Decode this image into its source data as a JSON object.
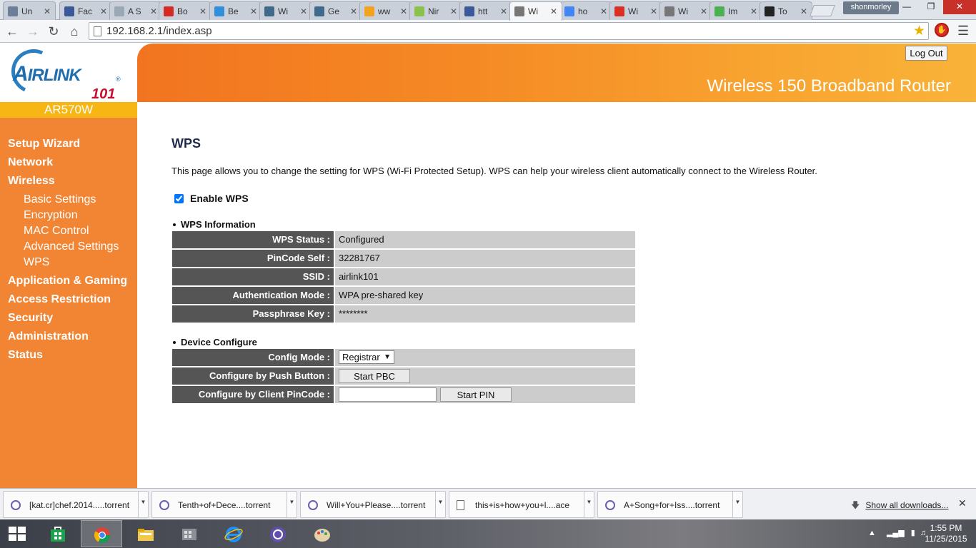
{
  "browser": {
    "tabs": [
      {
        "label": "Un",
        "color": "#6b7f99"
      },
      {
        "label": "Fac",
        "color": "#3b5998"
      },
      {
        "label": "A S",
        "color": "#9aa7b5"
      },
      {
        "label": "Bo",
        "color": "#d62b24"
      },
      {
        "label": "Be",
        "color": "#2f8fd8"
      },
      {
        "label": "Wi",
        "color": "#3f6a8a"
      },
      {
        "label": "Ge",
        "color": "#3f6a8a"
      },
      {
        "label": "ww",
        "color": "#f2a21d"
      },
      {
        "label": "Nir",
        "color": "#8bc34a"
      },
      {
        "label": "htt",
        "color": "#3b5998"
      },
      {
        "label": "Wi",
        "color": "#777777"
      },
      {
        "label": "ho",
        "color": "#4285f4"
      },
      {
        "label": "Wi",
        "color": "#d93025"
      },
      {
        "label": "Wi",
        "color": "#777777"
      },
      {
        "label": "Im",
        "color": "#4caf50"
      },
      {
        "label": "To",
        "color": "#222222"
      }
    ],
    "active_tab_index": 10,
    "profile_name": "shonmorley",
    "url": "192.168.2.1/index.asp"
  },
  "router": {
    "brand_logo": "AIRLINK",
    "brand_logo_small": "101",
    "model": "AR570W",
    "product_title": "Wireless 150 Broadband Router",
    "logout_label": "Log Out",
    "nav": [
      {
        "label": "Setup Wizard",
        "level": "main"
      },
      {
        "label": "Network",
        "level": "main"
      },
      {
        "label": "Wireless",
        "level": "main"
      },
      {
        "label": "Basic Settings",
        "level": "sub"
      },
      {
        "label": "Encryption",
        "level": "sub"
      },
      {
        "label": "MAC Control",
        "level": "sub"
      },
      {
        "label": "Advanced Settings",
        "level": "sub"
      },
      {
        "label": "WPS",
        "level": "sub"
      },
      {
        "label": "Application & Gaming",
        "level": "main"
      },
      {
        "label": "Access Restriction",
        "level": "main"
      },
      {
        "label": "Security",
        "level": "main"
      },
      {
        "label": "Administration",
        "level": "main"
      },
      {
        "label": "Status",
        "level": "main"
      }
    ]
  },
  "wps": {
    "title": "WPS",
    "description": "This page allows you to change the setting for WPS (Wi-Fi Protected Setup). WPS can help your wireless client automatically connect to the Wireless Router.",
    "enable_label": "Enable WPS",
    "enable_checked": true,
    "info_heading": "WPS Information",
    "info_rows": [
      {
        "label": "WPS Status :",
        "value": "Configured"
      },
      {
        "label": "PinCode Self :",
        "value": "32281767"
      },
      {
        "label": "SSID :",
        "value": "airlink101"
      },
      {
        "label": "Authentication Mode :",
        "value": "WPA pre-shared key"
      },
      {
        "label": "Passphrase Key :",
        "value": "********"
      }
    ],
    "device_heading": "Device Configure",
    "config_mode_label": "Config Mode :",
    "config_mode_value": "Registrar",
    "push_button_label": "Configure by Push Button :",
    "start_pbc_label": "Start PBC",
    "client_pin_label": "Configure by Client PinCode :",
    "client_pin_value": "",
    "start_pin_label": "Start PIN"
  },
  "downloads": {
    "items": [
      {
        "name": "[kat.cr]chef.2014.....torrent",
        "icon": "torrent-icon"
      },
      {
        "name": "Tenth+of+Dece....torrent",
        "icon": "torrent-icon"
      },
      {
        "name": "Will+You+Please....torrent",
        "icon": "torrent-icon"
      },
      {
        "name": "this+is+how+you+l....ace",
        "icon": "file-icon"
      },
      {
        "name": "A+Song+for+Iss....torrent",
        "icon": "torrent-icon"
      }
    ],
    "show_all_label": "Show all downloads..."
  },
  "taskbar": {
    "time": "1:55 PM",
    "date": "11/25/2015"
  }
}
